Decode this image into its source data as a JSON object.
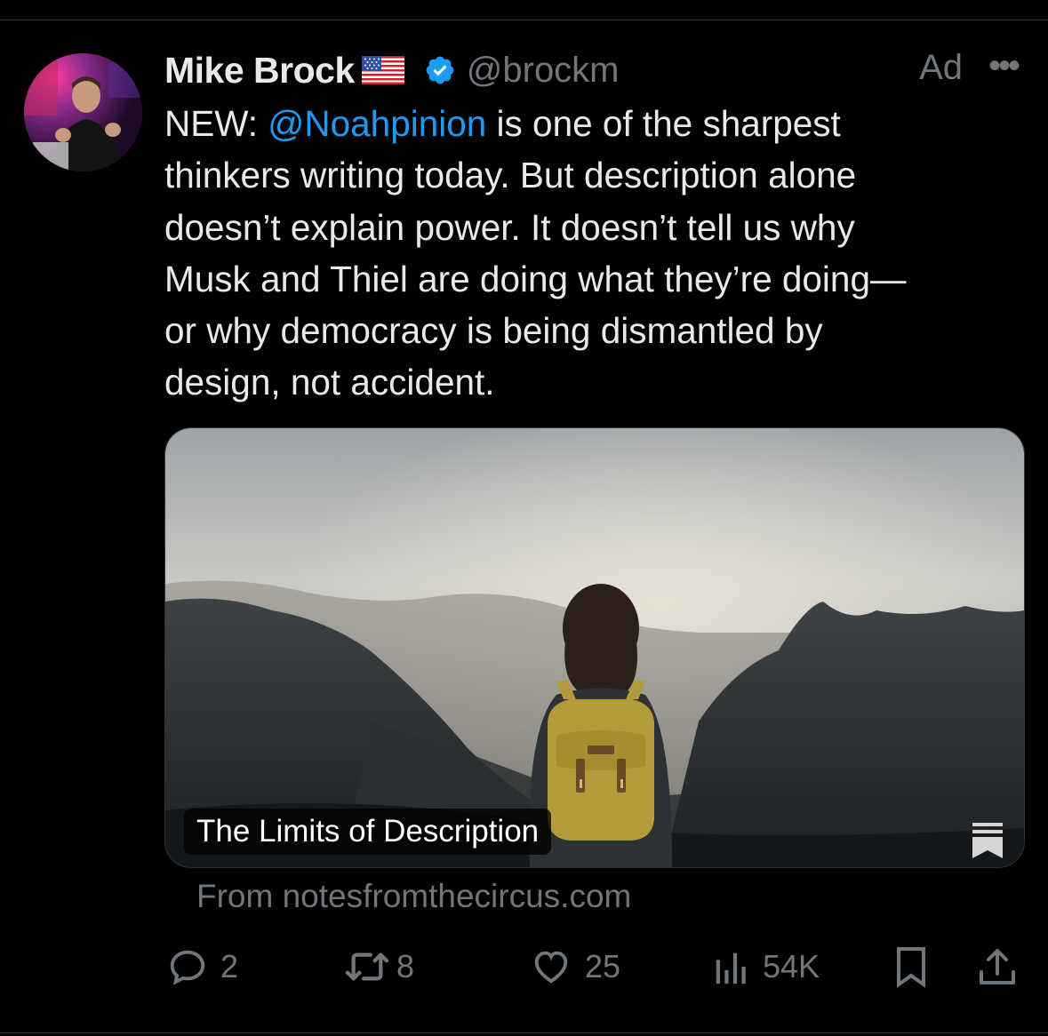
{
  "author": {
    "name": "Mike Brock",
    "flag": "🇺🇸",
    "verified": true,
    "handle": "@brockm"
  },
  "ad_label": "Ad",
  "more_label": "•••",
  "tweet": {
    "prefix": "NEW: ",
    "mention": "@Noahpinion",
    "body": " is one of the sharpest\nthinkers writing today. But description alone\ndoesn’t explain power. It doesn’t tell us why\nMusk and Thiel are doing what they’re doing—\nor why democracy is being dismantled by\ndesign, not accident."
  },
  "card": {
    "title": "The Limits of Description",
    "source": "From notesfromthecircus.com"
  },
  "actions": {
    "replies": "2",
    "reposts": "8",
    "likes": "25",
    "views": "54K"
  },
  "icons": {
    "reply": "reply-icon",
    "repost": "repost-icon",
    "like": "heart-icon",
    "views": "views-icon",
    "bookmark": "bookmark-icon",
    "share": "share-icon",
    "verified": "verified-badge-icon"
  },
  "colors": {
    "background": "#000000",
    "text": "#e7e9ea",
    "muted": "#71767b",
    "accent": "#1d9bf0"
  }
}
